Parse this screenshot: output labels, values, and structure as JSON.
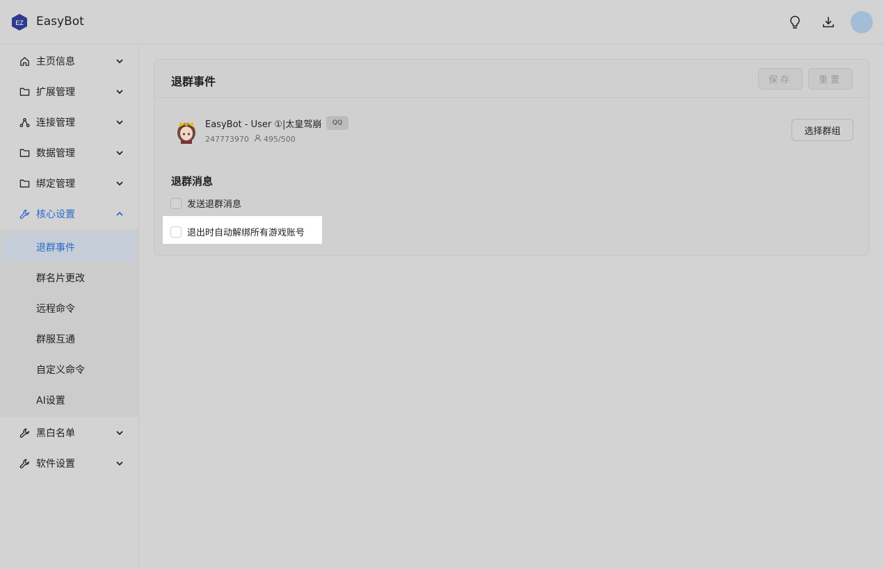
{
  "header": {
    "logo_text": "EZ",
    "app_title": "EasyBot",
    "icons": [
      "lightbulb-icon",
      "download-icon"
    ],
    "avatar_color": "#a3bcd8"
  },
  "sidebar": {
    "accent_color": "#2f6bcb",
    "items": [
      {
        "label": "主页信息",
        "icon": "home-icon"
      },
      {
        "label": "扩展管理",
        "icon": "folder-icon"
      },
      {
        "label": "连接管理",
        "icon": "network-icon"
      },
      {
        "label": "数据管理",
        "icon": "folder-icon"
      },
      {
        "label": "绑定管理",
        "icon": "folder-icon"
      },
      {
        "label": "核心设置",
        "icon": "wrench-icon",
        "expanded": true
      },
      {
        "label": "黑白名单",
        "icon": "wrench-icon"
      },
      {
        "label": "软件设置",
        "icon": "wrench-icon"
      }
    ],
    "subitems": [
      {
        "label": "退群事件",
        "selected": true
      },
      {
        "label": "群名片更改"
      },
      {
        "label": "远程命令"
      },
      {
        "label": "群服互通"
      },
      {
        "label": "自定义命令"
      },
      {
        "label": "AI设置"
      }
    ]
  },
  "main": {
    "title": "退群事件",
    "save_label": "保存",
    "reset_label": "重置",
    "group": {
      "name": "EasyBot - User ①|太皇驾崩",
      "badge": "QQ",
      "id": "247773970",
      "members": "495/500"
    },
    "select_group_label": "选择群组",
    "section_title": "退群消息",
    "options": [
      {
        "label": "发送退群消息",
        "checked": false
      },
      {
        "label": "退出时自动解绑所有游戏账号",
        "checked": false
      }
    ]
  }
}
